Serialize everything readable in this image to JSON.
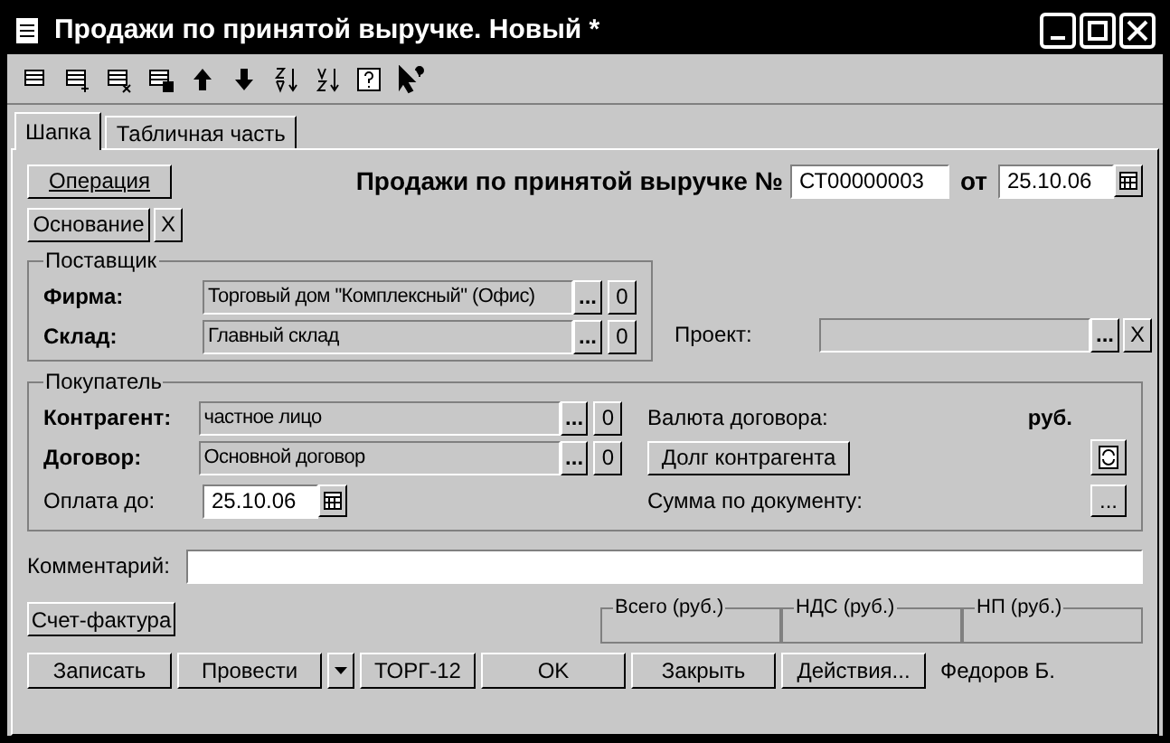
{
  "window": {
    "title": "Продажи по принятой выручке. Новый *"
  },
  "tabs": [
    {
      "label": "Шапка",
      "selected": true
    },
    {
      "label": "Табличная часть",
      "selected": false
    }
  ],
  "header": {
    "operation_button": "Операция",
    "doc_title": "Продажи по принятой выручке №",
    "number": "СТ00000003",
    "date_label": "от",
    "date": "25.10.06",
    "basis_button": "Основание",
    "clear_button": "X"
  },
  "supplier": {
    "title": "Поставщик",
    "fields": [
      {
        "label": "Фирма:",
        "required": true,
        "value": "Торговый дом \"Комплексный\" (Офис)",
        "select_button": "...",
        "open_button": "0"
      },
      {
        "label": "Склад:",
        "required": true,
        "value": "Главный склад",
        "select_button": "...",
        "open_button": "0"
      }
    ]
  },
  "project": {
    "label": "Проект:",
    "select_button": "...",
    "clear_button": "X"
  },
  "buyer": {
    "title": "Покупатель",
    "fields": [
      {
        "label": "Контрагент:",
        "required": true,
        "value": "частное лицо",
        "select_button": "...",
        "open_button": "0"
      },
      {
        "label": "Договор:",
        "required": true,
        "value": "Основной договор",
        "select_button": "...",
        "open_button": "0"
      }
    ],
    "pay_until": {
      "label": "Оплата до:",
      "required": false,
      "value": "25.10.06"
    },
    "currency_label": "Валюта договора:",
    "currency": "руб.",
    "debt_button": "Долг контрагента",
    "sum_label": "Сумма по документу:",
    "sum_button": "..."
  },
  "comment": {
    "label": "Комментарий:"
  },
  "invoice_button": "Счет-фактура",
  "totals": [
    {
      "label": "Всего (руб.)"
    },
    {
      "label": "НДС (руб.)"
    },
    {
      "label": "НП (руб.)"
    }
  ],
  "buttons": [
    {
      "kind": "button",
      "label": "Записать"
    },
    {
      "kind": "button",
      "label": "Провести"
    },
    {
      "kind": "dropdown"
    },
    {
      "kind": "button",
      "label": "ТОРГ-12"
    },
    {
      "kind": "button",
      "label": "OK"
    },
    {
      "kind": "button",
      "label": "Закрыть"
    },
    {
      "kind": "button",
      "label": "Действия..."
    }
  ],
  "user": "Федоров Б."
}
